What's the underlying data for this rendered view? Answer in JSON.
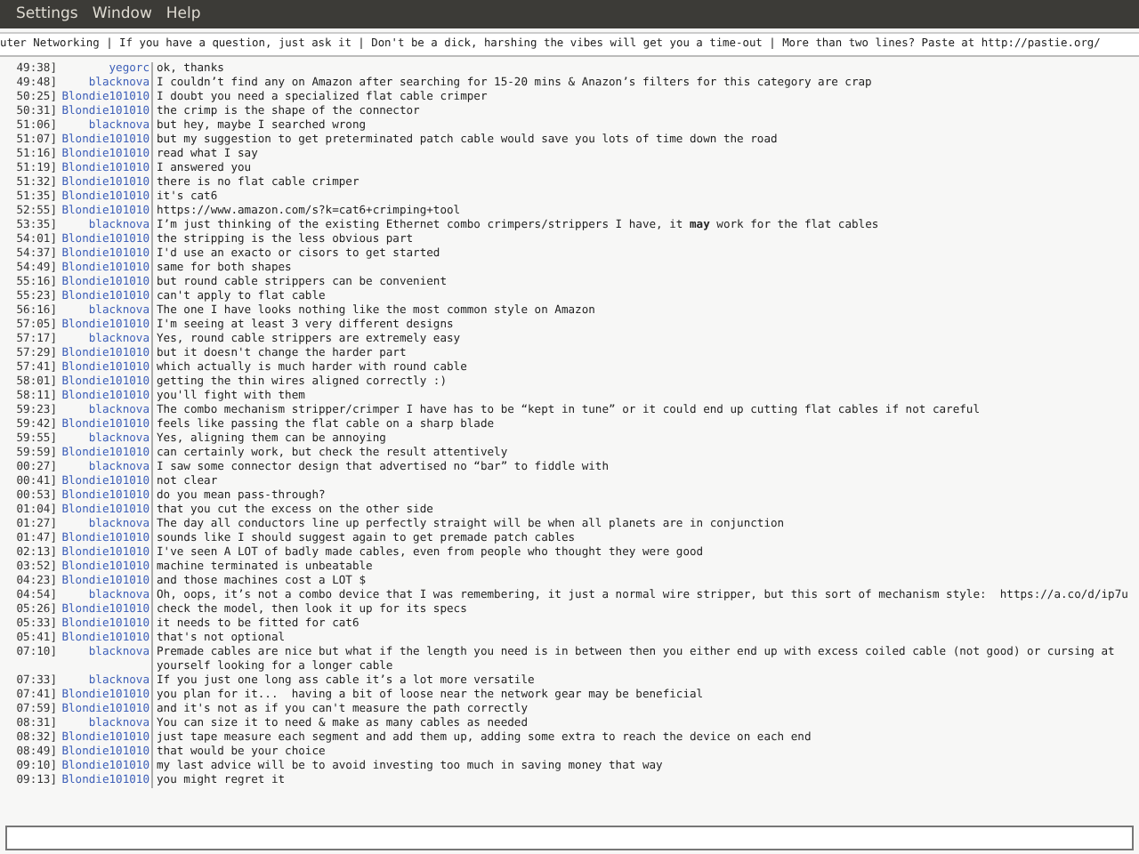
{
  "menu": [
    "Settings",
    "Window",
    "Help"
  ],
  "topic": "uter Networking | If you have a question, just ask it | Don't be a dick, harshing the vibes will get you a time-out | More than two lines? Paste at http://pastie.org/",
  "messages": [
    {
      "time": "49:38]",
      "nick": "yegorc",
      "text": "ok, thanks"
    },
    {
      "time": "49:48]",
      "nick": "blacknova",
      "text": "I couldn’t find any on Amazon after searching for 15-20 mins & Anazon’s filters for this category are crap"
    },
    {
      "time": "50:25]",
      "nick": "Blondie101010",
      "text": "I doubt you need a specialized flat cable crimper"
    },
    {
      "time": "50:31]",
      "nick": "Blondie101010",
      "text": "the crimp is the shape of the connector"
    },
    {
      "time": "51:06]",
      "nick": "blacknova",
      "text": "but hey, maybe I searched wrong"
    },
    {
      "time": "51:07]",
      "nick": "Blondie101010",
      "text": "but my suggestion to get preterminated patch cable would save you lots of time down the road"
    },
    {
      "time": "51:16]",
      "nick": "Blondie101010",
      "text": "read what I say"
    },
    {
      "time": "51:19]",
      "nick": "Blondie101010",
      "text": "I answered you"
    },
    {
      "time": "51:32]",
      "nick": "Blondie101010",
      "text": "there is no flat cable crimper"
    },
    {
      "time": "51:35]",
      "nick": "Blondie101010",
      "text": "it's cat6"
    },
    {
      "time": "52:55]",
      "nick": "Blondie101010",
      "text": "https://www.amazon.com/s?k=cat6+crimping+tool"
    },
    {
      "time": "53:35]",
      "nick": "blacknova",
      "text": "I’m just thinking of the existing Ethernet combo crimpers/strippers I have, it **may** work for the flat cables"
    },
    {
      "time": "54:01]",
      "nick": "Blondie101010",
      "text": "the stripping is the less obvious part"
    },
    {
      "time": "54:37]",
      "nick": "Blondie101010",
      "text": "I'd use an exacto or cisors to get started"
    },
    {
      "time": "54:49]",
      "nick": "Blondie101010",
      "text": "same for both shapes"
    },
    {
      "time": "55:16]",
      "nick": "Blondie101010",
      "text": "but round cable strippers can be convenient"
    },
    {
      "time": "55:23]",
      "nick": "Blondie101010",
      "text": "can't apply to flat cable"
    },
    {
      "time": "56:16]",
      "nick": "blacknova",
      "text": "The one I have looks nothing like the most common style on Amazon"
    },
    {
      "time": "57:05]",
      "nick": "Blondie101010",
      "text": "I'm seeing at least 3 very different designs"
    },
    {
      "time": "57:17]",
      "nick": "blacknova",
      "text": "Yes, round cable strippers are extremely easy"
    },
    {
      "time": "57:29]",
      "nick": "Blondie101010",
      "text": "but it doesn't change the harder part"
    },
    {
      "time": "57:41]",
      "nick": "Blondie101010",
      "text": "which actually is much harder with round cable"
    },
    {
      "time": "58:01]",
      "nick": "Blondie101010",
      "text": "getting the thin wires aligned correctly :)"
    },
    {
      "time": "58:11]",
      "nick": "Blondie101010",
      "text": "you'll fight with them"
    },
    {
      "time": "59:23]",
      "nick": "blacknova",
      "text": "The combo mechanism stripper/crimper I have has to be “kept in tune” or it could end up cutting flat cables if not careful"
    },
    {
      "time": "59:42]",
      "nick": "Blondie101010",
      "text": "feels like passing the flat cable on a sharp blade"
    },
    {
      "time": "59:55]",
      "nick": "blacknova",
      "text": "Yes, aligning them can be annoying"
    },
    {
      "time": "59:59]",
      "nick": "Blondie101010",
      "text": "can certainly work, but check the result attentively"
    },
    {
      "time": "00:27]",
      "nick": "blacknova",
      "text": "I saw some connector design that advertised no “bar” to fiddle with"
    },
    {
      "time": "00:41]",
      "nick": "Blondie101010",
      "text": "not clear"
    },
    {
      "time": "00:53]",
      "nick": "Blondie101010",
      "text": "do you mean pass-through?"
    },
    {
      "time": "01:04]",
      "nick": "Blondie101010",
      "text": "that you cut the excess on the other side"
    },
    {
      "time": "01:27]",
      "nick": "blacknova",
      "text": "The day all conductors line up perfectly straight will be when all planets are in conjunction"
    },
    {
      "time": "01:47]",
      "nick": "Blondie101010",
      "text": "sounds like I should suggest again to get premade patch cables"
    },
    {
      "time": "02:13]",
      "nick": "Blondie101010",
      "text": "I've seen A LOT of badly made cables, even from people who thought they were good"
    },
    {
      "time": "03:52]",
      "nick": "Blondie101010",
      "text": "machine terminated is unbeatable"
    },
    {
      "time": "04:23]",
      "nick": "Blondie101010",
      "text": "and those machines cost a LOT $"
    },
    {
      "time": "04:54]",
      "nick": "blacknova",
      "text": "Oh, oops, it’s not a combo device that I was remembering, it just a normal wire stripper, but this sort of mechanism style:  https://a.co/d/ip7u"
    },
    {
      "time": "05:26]",
      "nick": "Blondie101010",
      "text": "check the model, then look it up for its specs"
    },
    {
      "time": "05:33]",
      "nick": "Blondie101010",
      "text": "it needs to be fitted for cat6"
    },
    {
      "time": "05:41]",
      "nick": "Blondie101010",
      "text": "that's not optional"
    },
    {
      "time": "07:10]",
      "nick": "blacknova",
      "text": "Premade cables are nice but what if the length you need is in between then you either end up with excess coiled cable (not good) or cursing at yourself looking for a longer cable"
    },
    {
      "time": "07:33]",
      "nick": "blacknova",
      "text": "If you just one long ass cable it’s a lot more versatile"
    },
    {
      "time": "07:41]",
      "nick": "Blondie101010",
      "text": "you plan for it...  having a bit of loose near the network gear may be beneficial"
    },
    {
      "time": "07:59]",
      "nick": "Blondie101010",
      "text": "and it's not as if you can't measure the path correctly"
    },
    {
      "time": "08:31]",
      "nick": "blacknova",
      "text": "You can size it to need & make as many cables as needed"
    },
    {
      "time": "08:32]",
      "nick": "Blondie101010",
      "text": "just tape measure each segment and add them up, adding some extra to reach the device on each end"
    },
    {
      "time": "08:49]",
      "nick": "Blondie101010",
      "text": "that would be your choice"
    },
    {
      "time": "09:10]",
      "nick": "Blondie101010",
      "text": "my last advice will be to avoid investing too much in saving money that way"
    },
    {
      "time": "09:13]",
      "nick": "Blondie101010",
      "text": "you might regret it"
    }
  ]
}
